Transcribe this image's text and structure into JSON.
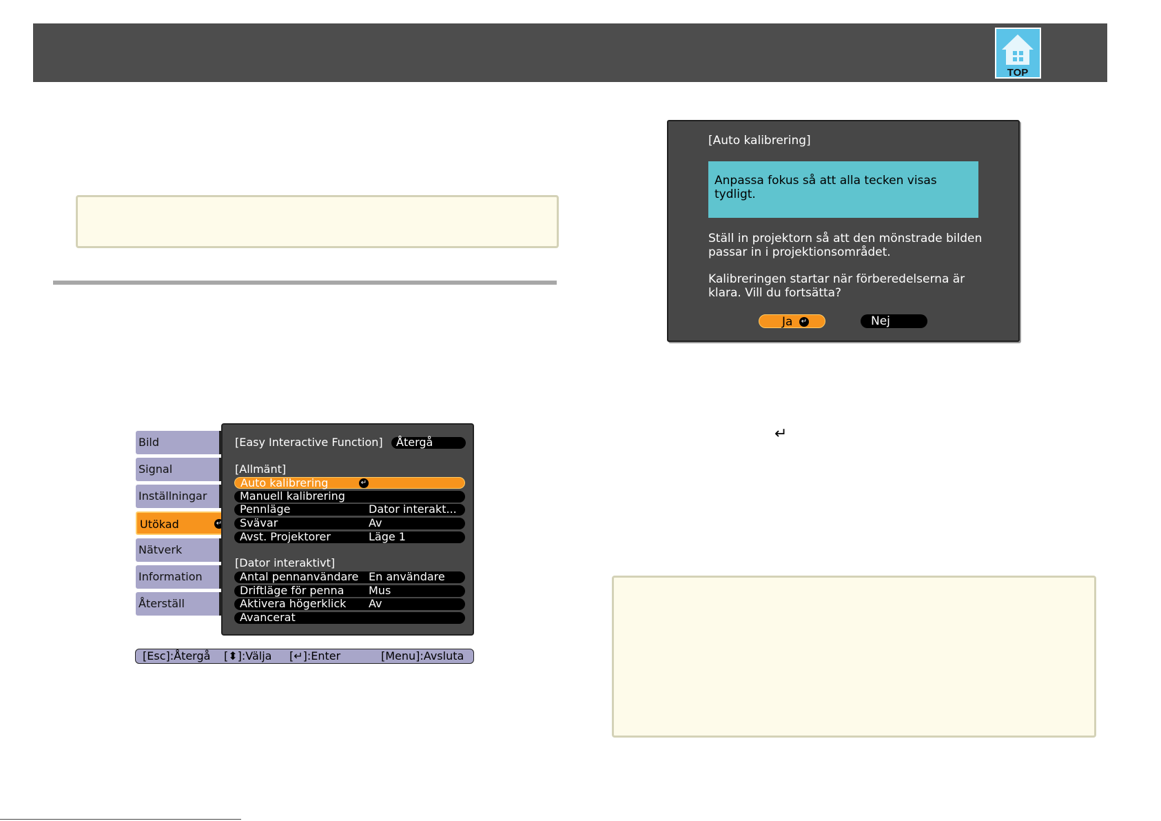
{
  "header": {
    "top_icon_label": "TOP",
    "icon": "home-icon"
  },
  "menu": {
    "left_items": [
      {
        "label": "Bild"
      },
      {
        "label": "Signal"
      },
      {
        "label": "Inställningar"
      },
      {
        "label": "Utökad"
      },
      {
        "label": "Nätverk"
      },
      {
        "label": "Information"
      },
      {
        "label": "Återställ"
      }
    ],
    "panel_title": "[Easy Interactive Function]",
    "back_label": "Återgå",
    "section_general": "[Allmänt]",
    "general_rows": [
      {
        "label": "Auto kalibrering",
        "value": ""
      },
      {
        "label": "Manuell kalibrering",
        "value": ""
      },
      {
        "label": "Pennläge",
        "value": "Dator interakt..."
      },
      {
        "label": "Svävar",
        "value": "Av"
      },
      {
        "label": "Avst. Projektorer",
        "value": "Läge 1"
      }
    ],
    "section_computer": "[Dator interaktivt]",
    "computer_rows": [
      {
        "label": "Antal pennanvändare",
        "value": "En användare"
      },
      {
        "label": "Driftläge för penna",
        "value": "Mus"
      },
      {
        "label": "Aktivera högerklick",
        "value": "Av"
      },
      {
        "label": "Avancerat",
        "value": ""
      }
    ],
    "statusbar": {
      "esc": "[Esc]:Återgå",
      "select": "[⬍]:Välja",
      "enter": "[↵]:Enter",
      "menu": "[Menu]:Avsluta"
    }
  },
  "dialog": {
    "title": "[Auto kalibrering]",
    "highlight": "Anpassa fokus så att alla tecken visas tydligt.",
    "para1": "Ställ in projektorn så att den mönstrade bilden passar in i projektionsområdet.",
    "para2": "Kalibreringen startar när förberedelserna är klara. Vill du fortsätta?",
    "yes": "Ja",
    "no": "Nej"
  },
  "return_glyph": "↵"
}
